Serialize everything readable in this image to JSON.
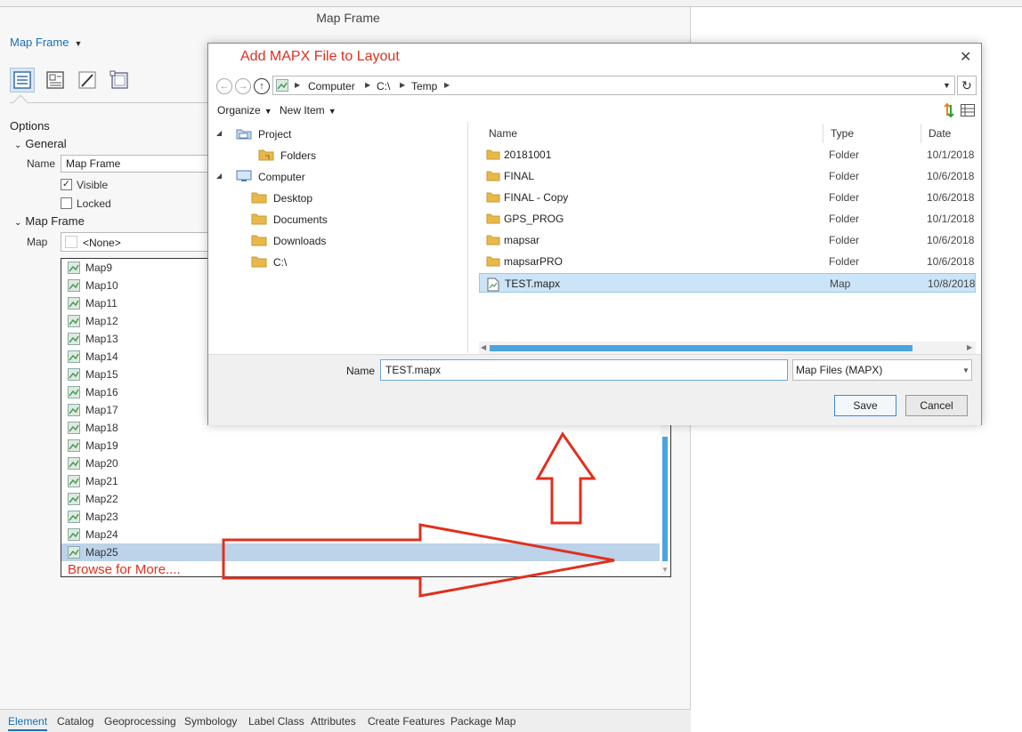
{
  "panel": {
    "title": "Map Frame",
    "element_dropdown": "Map Frame",
    "options_label": "Options",
    "general_label": "General",
    "name_label": "Name",
    "name_value": "Map Frame",
    "visible_label": "Visible",
    "visible_checked": true,
    "locked_label": "Locked",
    "locked_checked": false,
    "map_frame_label": "Map Frame",
    "map_label": "Map",
    "map_value": "<None>",
    "map_list": [
      "Map9",
      "Map10",
      "Map11",
      "Map12",
      "Map13",
      "Map14",
      "Map15",
      "Map16",
      "Map17",
      "Map18",
      "Map19",
      "Map20",
      "Map21",
      "Map22",
      "Map23",
      "Map24",
      "Map25"
    ],
    "selected_map": "Map25",
    "browse_label": "Browse for More...."
  },
  "bottom_tabs": [
    "Element",
    "Catalog",
    "Geoprocessing",
    "Symbology",
    "Label Class",
    "Attributes",
    "Create Features",
    "Package Map"
  ],
  "active_tab": "Element",
  "dialog": {
    "title": "Add MAPX File to Layout",
    "breadcrumb": [
      "Computer",
      "C:\\",
      "Temp"
    ],
    "organize_label": "Organize",
    "new_item_label": "New Item",
    "nav_tree": [
      {
        "label": "Project",
        "icon": "project-icon"
      },
      {
        "label": "Folders",
        "icon": "folder-icon"
      },
      {
        "label": "Computer",
        "icon": "computer-icon"
      },
      {
        "label": "Desktop",
        "icon": "folder-icon"
      },
      {
        "label": "Documents",
        "icon": "folder-icon"
      },
      {
        "label": "Downloads",
        "icon": "folder-icon"
      },
      {
        "label": "C:\\",
        "icon": "folder-icon"
      }
    ],
    "columns": [
      "Name",
      "Type",
      "Date"
    ],
    "files": [
      {
        "name": "20181001",
        "type": "Folder",
        "date": "10/1/2018"
      },
      {
        "name": "FINAL",
        "type": "Folder",
        "date": "10/6/2018"
      },
      {
        "name": "FINAL - Copy",
        "type": "Folder",
        "date": "10/6/2018"
      },
      {
        "name": "GPS_PROG",
        "type": "Folder",
        "date": "10/1/2018"
      },
      {
        "name": "mapsar",
        "type": "Folder",
        "date": "10/6/2018"
      },
      {
        "name": "mapsarPRO",
        "type": "Folder",
        "date": "10/6/2018"
      },
      {
        "name": "TEST.mapx",
        "type": "Map",
        "date": "10/8/2018"
      }
    ],
    "name_label": "Name",
    "file_name_value": "TEST.mapx",
    "file_type_value": "Map Files (MAPX)",
    "save_label": "Save",
    "cancel_label": "Cancel"
  },
  "colors": {
    "accent": "#1a6fb6",
    "annotation_red": "#e0301e",
    "selection": "#bcd3ea",
    "folder": "#e8b84a"
  }
}
